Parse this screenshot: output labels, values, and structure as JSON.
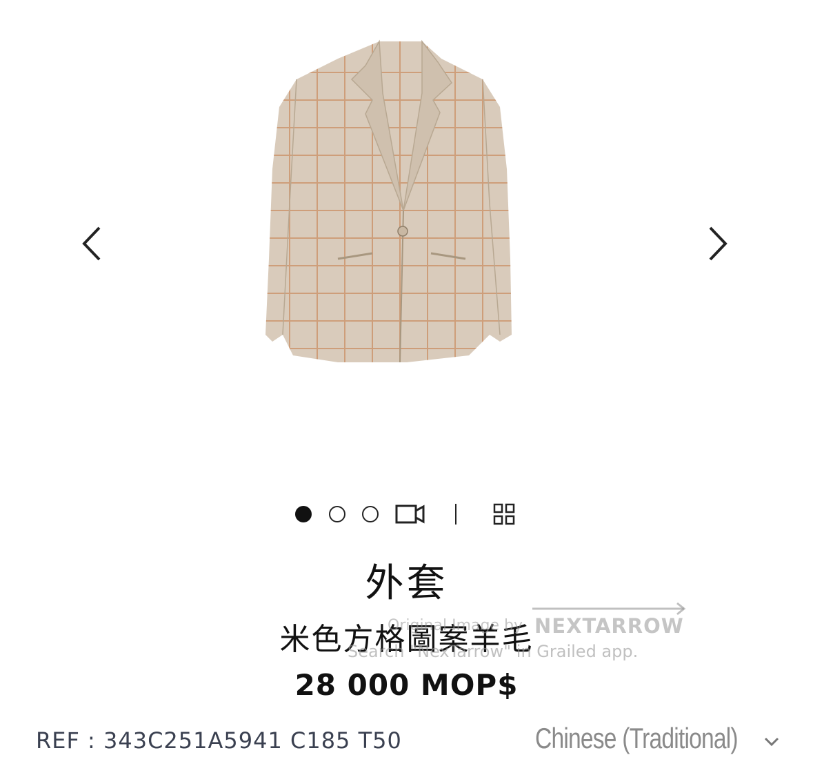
{
  "gallery": {
    "image_name": "beige-check-wool-jacket",
    "prev_icon": "chevron-left-icon",
    "next_icon": "chevron-right-icon"
  },
  "pager": {
    "dots": 3,
    "active_index": 0,
    "video_icon": "video-camera-icon",
    "grid_icon": "grid-view-icon"
  },
  "product": {
    "title": "外套",
    "subtitle": "米色方格圖案羊毛",
    "price": "28 000 MOP$",
    "ref": "REF : 343C251A5941 C185 T50"
  },
  "language": {
    "label": "Chinese (Traditional)",
    "icon": "chevron-down-icon"
  },
  "watermark": {
    "logo": "NEXTARROW",
    "line1": "Original Image by",
    "line2": "Search \"NexTarrow\" in Grailed app."
  },
  "colors": {
    "text": "#111111",
    "ref_text": "#3a4050",
    "muted": "#8a8a8a",
    "jacket": "#d9cbbb",
    "check": "#c98a5e"
  }
}
